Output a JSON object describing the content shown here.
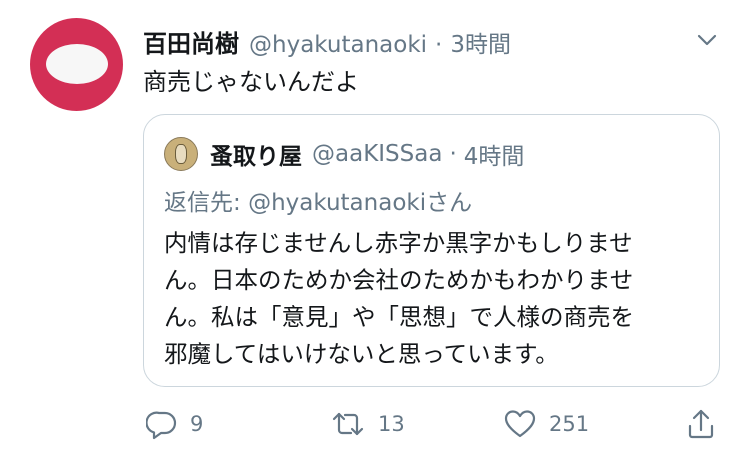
{
  "tweet": {
    "author_name": "百田尚樹",
    "author_handle": "@hyakutanaoki",
    "separator": "·",
    "timestamp": "3時間",
    "text": "商売じゃないんだよ"
  },
  "quote": {
    "author_name": "蚤取り屋",
    "author_handle": "@aaKISSaa",
    "separator": "·",
    "timestamp": "4時間",
    "reply_prefix": "返信先: ",
    "reply_handle": "@hyakutanaoki",
    "reply_suffix": "さん",
    "lines": [
      "内情は存じませんし赤字か黒字かもしりませ",
      "ん。日本のためか会社のためかもわかりませ",
      "ん。私は「意見」や「思想」で人様の商売を",
      "邪魔してはいけないと思っています。"
    ]
  },
  "actions": {
    "reply_count": "9",
    "retweet_count": "13",
    "like_count": "251"
  },
  "icons": {
    "reply": "reply-icon",
    "retweet": "retweet-icon",
    "like": "heart-icon",
    "share": "share-icon",
    "menu": "chevron-down-icon"
  },
  "colors": {
    "avatar_bg": "#d32f55",
    "secondary_text": "#657786",
    "border": "#ccd6dd"
  }
}
